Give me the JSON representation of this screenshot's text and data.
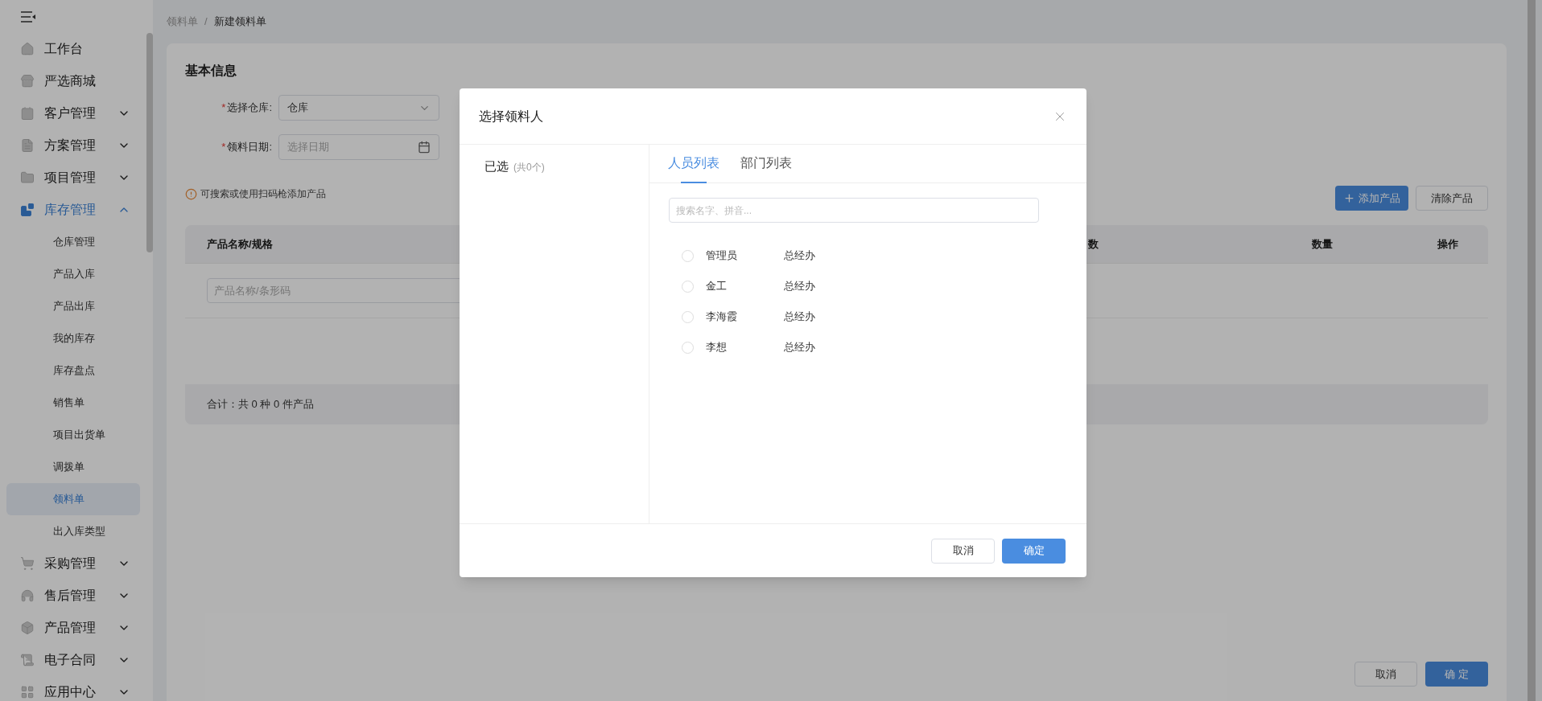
{
  "sidebar": {
    "items": [
      {
        "label": "工作台"
      },
      {
        "label": "严选商城"
      },
      {
        "label": "客户管理",
        "expanded": false
      },
      {
        "label": "方案管理",
        "expanded": false
      },
      {
        "label": "项目管理",
        "expanded": false
      },
      {
        "label": "库存管理",
        "expanded": true,
        "children": [
          {
            "label": "仓库管理",
            "selected": false
          },
          {
            "label": "产品入库",
            "selected": false
          },
          {
            "label": "产品出库",
            "selected": false
          },
          {
            "label": "我的库存",
            "selected": false
          },
          {
            "label": "库存盘点",
            "selected": false
          },
          {
            "label": "销售单",
            "selected": false
          },
          {
            "label": "项目出货单",
            "selected": false
          },
          {
            "label": "调拨单",
            "selected": false
          },
          {
            "label": "领料单",
            "selected": true
          },
          {
            "label": "出入库类型",
            "selected": false
          }
        ]
      },
      {
        "label": "采购管理",
        "expanded": false
      },
      {
        "label": "售后管理",
        "expanded": false
      },
      {
        "label": "产品管理",
        "expanded": false
      },
      {
        "label": "电子合同",
        "expanded": false
      },
      {
        "label": "应用中心",
        "expanded": false
      }
    ]
  },
  "breadcrumb": [
    "领料单",
    "新建领料单"
  ],
  "breadcrumb_separator": "/",
  "required_mark": "*",
  "form": {
    "title": "基本信息",
    "fields": [
      {
        "kind": "select",
        "label": "选择仓库:",
        "required": true,
        "value": "仓库"
      },
      {
        "kind": "date",
        "label": "领料日期:",
        "required": true,
        "placeholder": "选择日期"
      }
    ],
    "hint": "可搜索或使用扫码枪添加产品"
  },
  "product_buttons": {
    "add": "添加产品",
    "clear": "清除产品"
  },
  "table": {
    "columns": [
      "产品名称/规格",
      "数",
      "数量",
      "操作"
    ],
    "input_placeholder": "产品名称/条形码",
    "summary": "合计：共 0 种 0 件产品"
  },
  "footer_buttons": [
    "取消",
    "确 定"
  ],
  "modal": {
    "title": "选择领料人",
    "selected_label": "已选",
    "selected_count": "(共0个)",
    "tabs": [
      {
        "label": "人员列表",
        "selected": true
      },
      {
        "label": "部门列表",
        "selected": false
      }
    ],
    "search": {
      "placeholder": "搜索名字、拼音..."
    },
    "people": [
      {
        "name": "管理员",
        "dept": "总经办",
        "selected": false
      },
      {
        "name": "金工",
        "dept": "总经办",
        "selected": false
      },
      {
        "name": "李海霞",
        "dept": "总经办",
        "selected": false
      },
      {
        "name": "李想",
        "dept": "总经办",
        "selected": false
      }
    ],
    "buttons": [
      "取消",
      "确定"
    ]
  }
}
